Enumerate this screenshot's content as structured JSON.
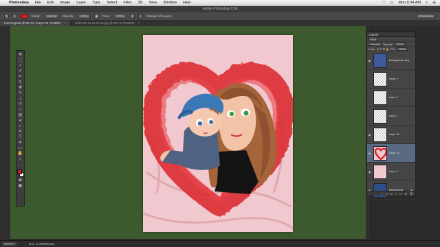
{
  "menubar": {
    "app_name": "Photoshop",
    "items": [
      "File",
      "Edit",
      "Image",
      "Layer",
      "Type",
      "Select",
      "Filter",
      "3D",
      "View",
      "Window",
      "Help"
    ],
    "clock": "Mon 8:34 AM"
  },
  "window": {
    "title": "Adobe Photoshop CS6"
  },
  "options_bar": {
    "mode_label": "Mode:",
    "mode_value": "Normal",
    "opacity_label": "Opacity:",
    "opacity_value": "100%",
    "flow_label": "Flow:",
    "flow_value": "100%",
    "sample_label": "Sample All Layers",
    "workspace": "Essentials"
  },
  "doc_tabs": [
    {
      "label": "mommypost @ 66.7% (Layer 21, RGB/8)",
      "close": "×",
      "active": true
    },
    {
      "label": "2013-09-18 22.03.53.jpg @ 66.7% (RGB/8)",
      "close": "×",
      "active": false
    }
  ],
  "status_bar": {
    "zoom": "66.67%",
    "doc": "Doc: 5.49M/85.6M"
  },
  "layers_panel": {
    "title": "Layers",
    "kind_label": "Kind",
    "blend_mode": "Normal",
    "opacity_label": "Opacity:",
    "opacity_value": "100%",
    "lock_label": "Lock:",
    "fill_label": "Fill:",
    "fill_value": "100%",
    "layers": [
      {
        "name": "Background copy",
        "visible": true,
        "selected": false
      },
      {
        "name": "Layer 3",
        "visible": false,
        "selected": false
      },
      {
        "name": "Layer 2",
        "visible": false,
        "selected": false
      },
      {
        "name": "Layer 1",
        "visible": false,
        "selected": false
      },
      {
        "name": "Layer 20",
        "visible": true,
        "selected": false
      },
      {
        "name": "Layer 21",
        "visible": true,
        "selected": true
      },
      {
        "name": "Layer 2",
        "visible": true,
        "selected": false
      },
      {
        "name": "Background",
        "visible": true,
        "selected": false,
        "locked": true
      }
    ]
  },
  "colors": {
    "canvas_bg": "#3d5a2e",
    "foreground": "#d41e1e",
    "background": "#ffffff",
    "artwork_pink": "#f1c8cf",
    "heart_red": "#d9262b"
  }
}
